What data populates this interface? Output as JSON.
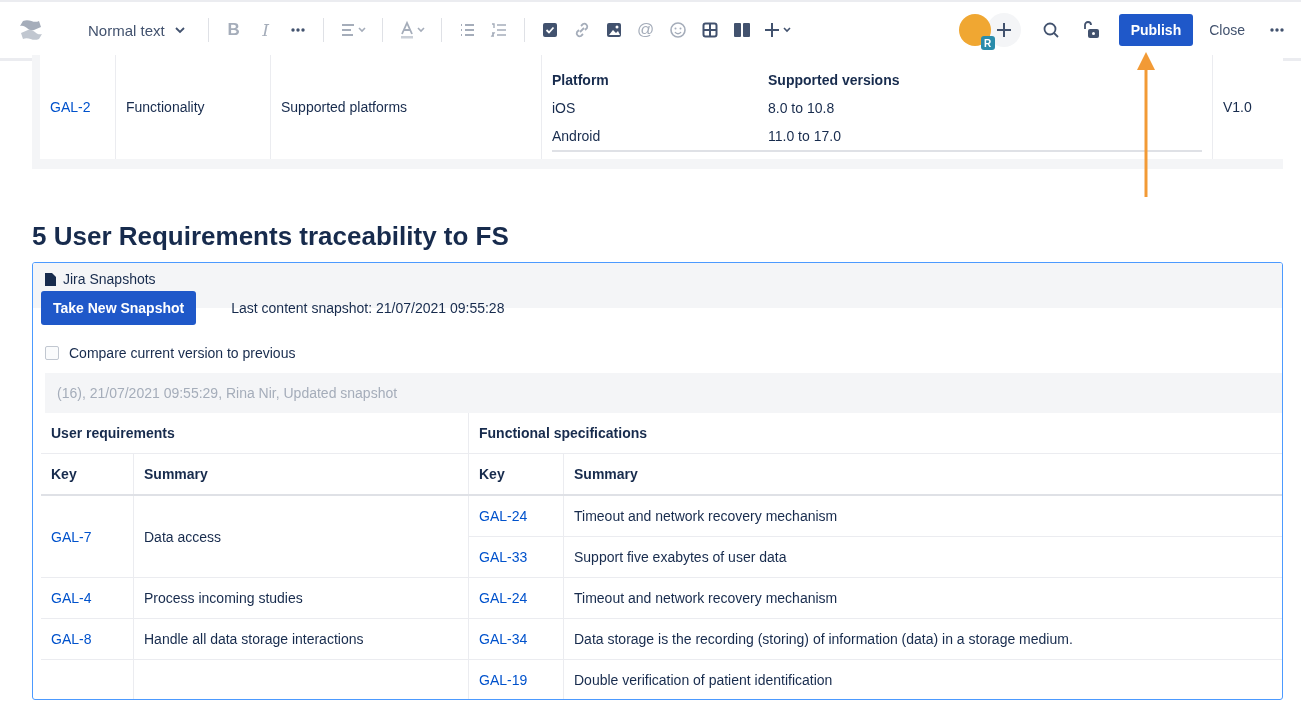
{
  "toolbar": {
    "text_style": "Normal text",
    "tools": [
      {
        "kind": "separator"
      },
      {
        "kind": "bold",
        "glyph": "B",
        "disabled": true
      },
      {
        "kind": "italic",
        "glyph": "I",
        "disabled": true
      },
      {
        "kind": "more",
        "disabled": false
      },
      {
        "kind": "separator"
      },
      {
        "kind": "align",
        "disabled": true
      },
      {
        "kind": "separator"
      },
      {
        "kind": "text-color",
        "disabled": true
      },
      {
        "kind": "separator"
      },
      {
        "kind": "bullet-list",
        "disabled": true
      },
      {
        "kind": "numbered-list",
        "disabled": true
      },
      {
        "kind": "separator"
      },
      {
        "kind": "action-item",
        "disabled": false
      },
      {
        "kind": "link",
        "disabled": true
      },
      {
        "kind": "image",
        "disabled": false
      },
      {
        "kind": "mention",
        "glyph": "@",
        "disabled": true
      },
      {
        "kind": "emoji",
        "disabled": true
      },
      {
        "kind": "table",
        "disabled": false
      },
      {
        "kind": "layout",
        "disabled": false
      },
      {
        "kind": "insert",
        "disabled": false
      }
    ],
    "avatar_badge": "R",
    "publish": "Publish",
    "close": "Close"
  },
  "requirement_row": {
    "key": "GAL-2",
    "category": "Functionality",
    "title": "Supported platforms",
    "platform_table": {
      "columns": [
        "Platform",
        "Supported versions"
      ],
      "rows": [
        [
          "iOS",
          "8.0 to 10.8"
        ],
        [
          "Android",
          "11.0 to 17.0"
        ]
      ]
    },
    "version": "V1.0"
  },
  "heading": "5 User Requirements traceability to FS",
  "macro": {
    "title": "Jira Snapshots",
    "button": "Take New Snapshot",
    "last_snapshot": "Last content snapshot: 21/07/2021 09:55:28",
    "compare": {
      "label": "Compare current version to previous",
      "checked": false
    },
    "snapshot": "(16), 21/07/2021 09:55:29, Rina Nir, Updated snapshot",
    "groups": [
      "User requirements",
      "Functional specifications"
    ],
    "columns": [
      "Key",
      "Summary",
      "Key",
      "Summary"
    ],
    "rows": [
      {
        "key": "GAL-7",
        "summary": "Data access",
        "specs": [
          {
            "key": "GAL-24",
            "summary": "Timeout and network recovery mechanism"
          },
          {
            "key": "GAL-33",
            "summary": "Support five exabytes of user data"
          }
        ]
      },
      {
        "key": "GAL-4",
        "summary": "Process incoming studies",
        "specs": [
          {
            "key": "GAL-24",
            "summary": "Timeout and network recovery mechanism"
          }
        ]
      },
      {
        "key": "GAL-8",
        "summary": "Handle all data storage interactions",
        "specs": [
          {
            "key": "GAL-34",
            "summary": "Data storage is the recording (storing) of information (data) in a storage medium."
          }
        ]
      },
      {
        "key": "",
        "summary": "",
        "specs": [
          {
            "key": "GAL-19",
            "summary": "Double verification of patient identification"
          }
        ]
      }
    ]
  }
}
